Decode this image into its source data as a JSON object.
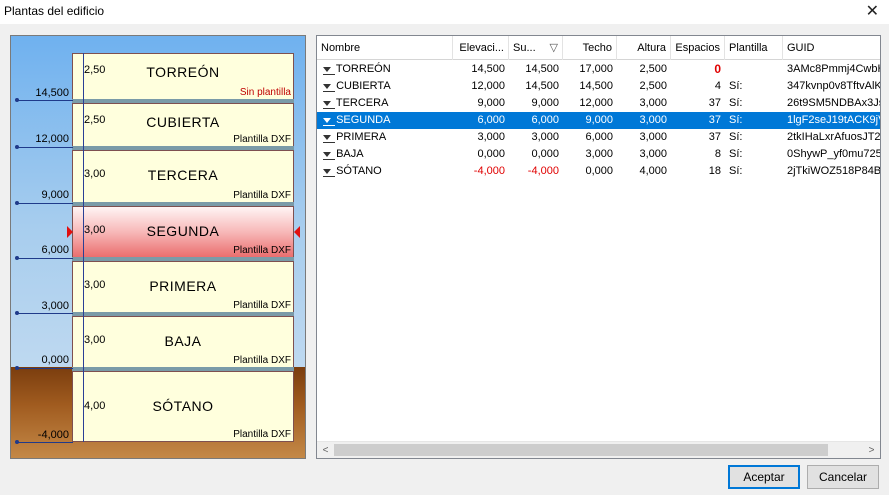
{
  "window": {
    "title": "Plantas del edificio"
  },
  "diagram": {
    "levels": [
      "14,500",
      "12,000",
      "9,000",
      "6,000",
      "3,000",
      "0,000",
      "-4,000"
    ],
    "floors": [
      {
        "name": "TORREÓN",
        "height": "2,50",
        "template": "Sin plantilla"
      },
      {
        "name": "CUBIERTA",
        "height": "2,50",
        "template": "Plantilla DXF"
      },
      {
        "name": "TERCERA",
        "height": "3,00",
        "template": "Plantilla DXF"
      },
      {
        "name": "SEGUNDA",
        "height": "3,00",
        "template": "Plantilla DXF"
      },
      {
        "name": "PRIMERA",
        "height": "3,00",
        "template": "Plantilla DXF"
      },
      {
        "name": "BAJA",
        "height": "3,00",
        "template": "Plantilla DXF"
      },
      {
        "name": "SÓTANO",
        "height": "4,00",
        "template": "Plantilla DXF"
      }
    ]
  },
  "table": {
    "columns": [
      "Nombre",
      "Elevaci...",
      "Su...",
      "Techo",
      "Altura",
      "Espacios",
      "Plantilla",
      "GUID"
    ],
    "rows": [
      {
        "nombre": "TORREÓN",
        "elev": "14,500",
        "suelo": "14,500",
        "techo": "17,000",
        "altura": "2,500",
        "espacios": "0",
        "plantilla": "",
        "guid": "3AMc8Pmmj4CwbH"
      },
      {
        "nombre": "CUBIERTA",
        "elev": "12,000",
        "suelo": "14,500",
        "techo": "14,500",
        "altura": "2,500",
        "espacios": "4",
        "plantilla": "Sí:",
        "guid": "347kvnp0v8TftvAlK"
      },
      {
        "nombre": "TERCERA",
        "elev": "9,000",
        "suelo": "9,000",
        "techo": "12,000",
        "altura": "3,000",
        "espacios": "37",
        "plantilla": "Sí:",
        "guid": "26t9SM5NDBAx3Js"
      },
      {
        "nombre": "SEGUNDA",
        "elev": "6,000",
        "suelo": "6,000",
        "techo": "9,000",
        "altura": "3,000",
        "espacios": "37",
        "plantilla": "Sí:",
        "guid": "1lgF2seJ19tACK9jV"
      },
      {
        "nombre": "PRIMERA",
        "elev": "3,000",
        "suelo": "3,000",
        "techo": "6,000",
        "altura": "3,000",
        "espacios": "37",
        "plantilla": "Sí:",
        "guid": "2tkIHaLxrAfuosJT2"
      },
      {
        "nombre": "BAJA",
        "elev": "0,000",
        "suelo": "0,000",
        "techo": "3,000",
        "altura": "3,000",
        "espacios": "8",
        "plantilla": "Sí:",
        "guid": "0ShywP_yf0mu725"
      },
      {
        "nombre": "SÓTANO",
        "elev": "-4,000",
        "suelo": "-4,000",
        "techo": "0,000",
        "altura": "4,000",
        "espacios": "18",
        "plantilla": "Sí:",
        "guid": "2jTkiWOZ518P84B4"
      }
    ]
  },
  "buttons": {
    "accept": "Aceptar",
    "cancel": "Cancelar"
  },
  "colors": {
    "selection": "#0078d7",
    "negative": "#e00000",
    "selected_floor": "#ea6e6e"
  }
}
